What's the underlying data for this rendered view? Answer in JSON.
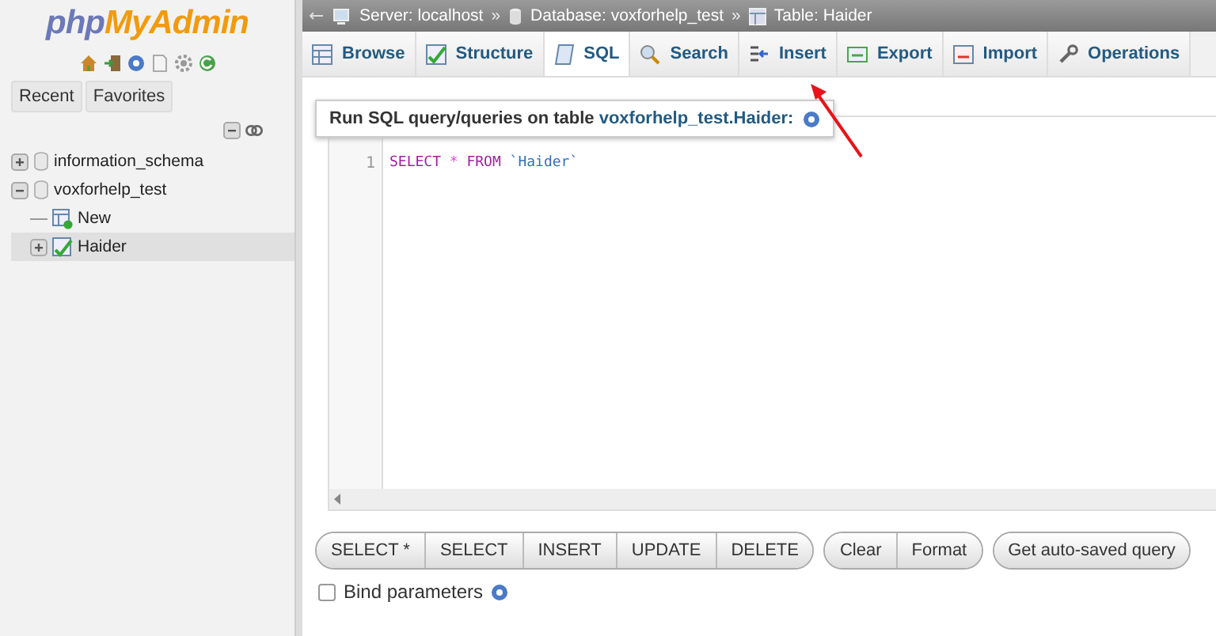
{
  "logo": {
    "part1": "php",
    "part2": "MyAdmin"
  },
  "sidebar": {
    "buttons": [
      "Recent",
      "Favorites"
    ],
    "tree": [
      {
        "label": "information_schema",
        "kind": "database",
        "expanded": false,
        "selected": false
      },
      {
        "label": "voxforhelp_test",
        "kind": "database",
        "expanded": true,
        "selected": false,
        "children": [
          {
            "label": "New",
            "kind": "new",
            "selected": false
          },
          {
            "label": "Haider",
            "kind": "table",
            "selected": true
          }
        ]
      }
    ]
  },
  "breadcrumb": [
    {
      "label": "Server: localhost",
      "kind": "server"
    },
    {
      "label": "Database: voxforhelp_test",
      "kind": "database"
    },
    {
      "label": "Table: Haider",
      "kind": "table"
    }
  ],
  "breadcrumb_separator": "»",
  "tabs": [
    {
      "label": "Browse",
      "kind": "browse",
      "selected": false
    },
    {
      "label": "Structure",
      "kind": "structure",
      "selected": false
    },
    {
      "label": "SQL",
      "kind": "sql",
      "selected": true
    },
    {
      "label": "Search",
      "kind": "search",
      "selected": false
    },
    {
      "label": "Insert",
      "kind": "insert",
      "selected": false
    },
    {
      "label": "Export",
      "kind": "export",
      "selected": false
    },
    {
      "label": "Import",
      "kind": "import",
      "selected": false
    },
    {
      "label": "Operations",
      "kind": "operations",
      "selected": false
    }
  ],
  "query_title": {
    "text": "Run SQL query/queries on table ",
    "link": "voxforhelp_test.Haider:"
  },
  "editor": {
    "lines": [
      {
        "number": "1",
        "tokens": [
          {
            "text": "SELECT",
            "kind": "keyword"
          },
          {
            "text": "*",
            "kind": "operator"
          },
          {
            "text": "FROM",
            "kind": "keyword"
          },
          {
            "text": "`Haider`",
            "kind": "identifier"
          }
        ]
      }
    ]
  },
  "button_groups": [
    [
      "SELECT *",
      "SELECT",
      "INSERT",
      "UPDATE",
      "DELETE"
    ],
    [
      "Clear",
      "Format"
    ],
    [
      "Get auto-saved query"
    ]
  ],
  "bind_parameters": {
    "label": "Bind parameters",
    "checked": false
  },
  "annotation": {
    "kind": "arrow"
  }
}
